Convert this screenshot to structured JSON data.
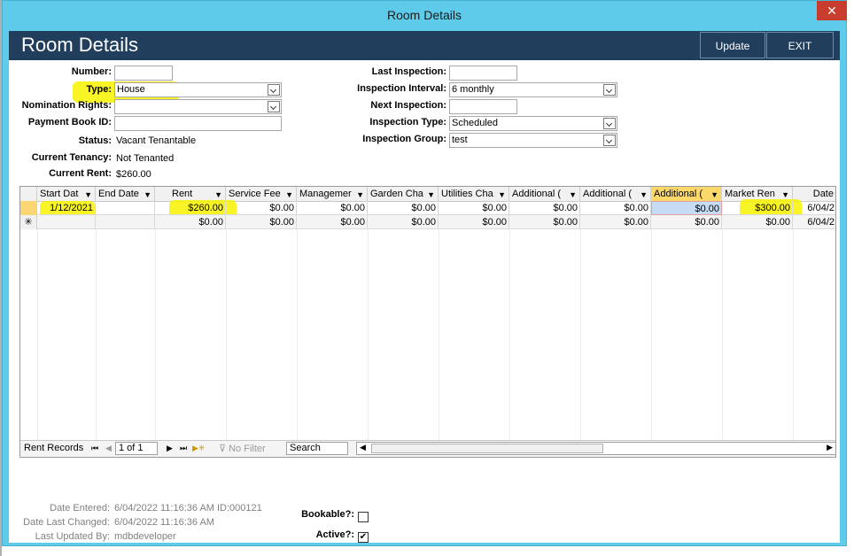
{
  "window": {
    "title": "Room Details",
    "close_glyph": "✕"
  },
  "header": {
    "title": "Room Details",
    "update_label": "Update",
    "exit_label": "EXIT"
  },
  "left_fields": {
    "number_label": "Number:",
    "number_value": "",
    "type_label": "Type:",
    "type_value": "House",
    "nomination_label": "Nomination Rights:",
    "nomination_value": "",
    "payment_label": "Payment Book ID:",
    "payment_value": "",
    "status_label": "Status:",
    "status_value": "Vacant Tenantable",
    "tenancy_label": "Current Tenancy:",
    "tenancy_value": "Not Tenanted",
    "rent_label": "Current Rent:",
    "rent_value": "$260.00"
  },
  "right_fields": {
    "last_insp_label": "Last Inspection:",
    "last_insp_value": "",
    "interval_label": "Inspection Interval:",
    "interval_value": "6 monthly",
    "next_insp_label": "Next Inspection:",
    "next_insp_value": "",
    "insp_type_label": "Inspection Type:",
    "insp_type_value": "Scheduled",
    "insp_group_label": "Inspection Group:",
    "insp_group_value": "test"
  },
  "grid": {
    "columns": [
      "Start Dat",
      "End Date",
      "Rent",
      "Service Fee",
      "Managemer",
      "Garden Cha",
      "Utilities Cha",
      "Additional (",
      "Additional (",
      "Additional (",
      "Market Ren",
      "Date"
    ],
    "rows": [
      [
        "1/12/2021",
        "",
        "$260.00",
        "$0.00",
        "$0.00",
        "$0.00",
        "$0.00",
        "$0.00",
        "$0.00",
        "$0.00",
        "$300.00",
        "6/04/2"
      ],
      [
        "",
        "",
        "$0.00",
        "$0.00",
        "$0.00",
        "$0.00",
        "$0.00",
        "$0.00",
        "$0.00",
        "$0.00",
        "$0.00",
        "6/04/2"
      ]
    ],
    "new_row_glyph": "✳"
  },
  "nav": {
    "label": "Rent Records",
    "first": "⏮",
    "prev": "◀",
    "record": "1 of 1",
    "next": "▶",
    "last": "⏭",
    "new": "▶✳",
    "filter_label": "No Filter",
    "search_label": "Search"
  },
  "footer": {
    "entered_label": "Date Entered:",
    "entered_value": "6/04/2022 11:16:36 AM ID:000121",
    "changed_label": "Date Last Changed:",
    "changed_value": "6/04/2022 11:16:36 AM",
    "updated_label": "Last Updated By:",
    "updated_value": "mdbdeveloper",
    "bookable_label": "Bookable?:",
    "bookable_checked": false,
    "active_label": "Active?:",
    "active_checked": true,
    "check_glyph": "✔"
  },
  "colors": {
    "header_bg": "#213e5c",
    "window_frame": "#5fcbea",
    "highlight": "#f7f200",
    "close": "#c83d2e"
  }
}
